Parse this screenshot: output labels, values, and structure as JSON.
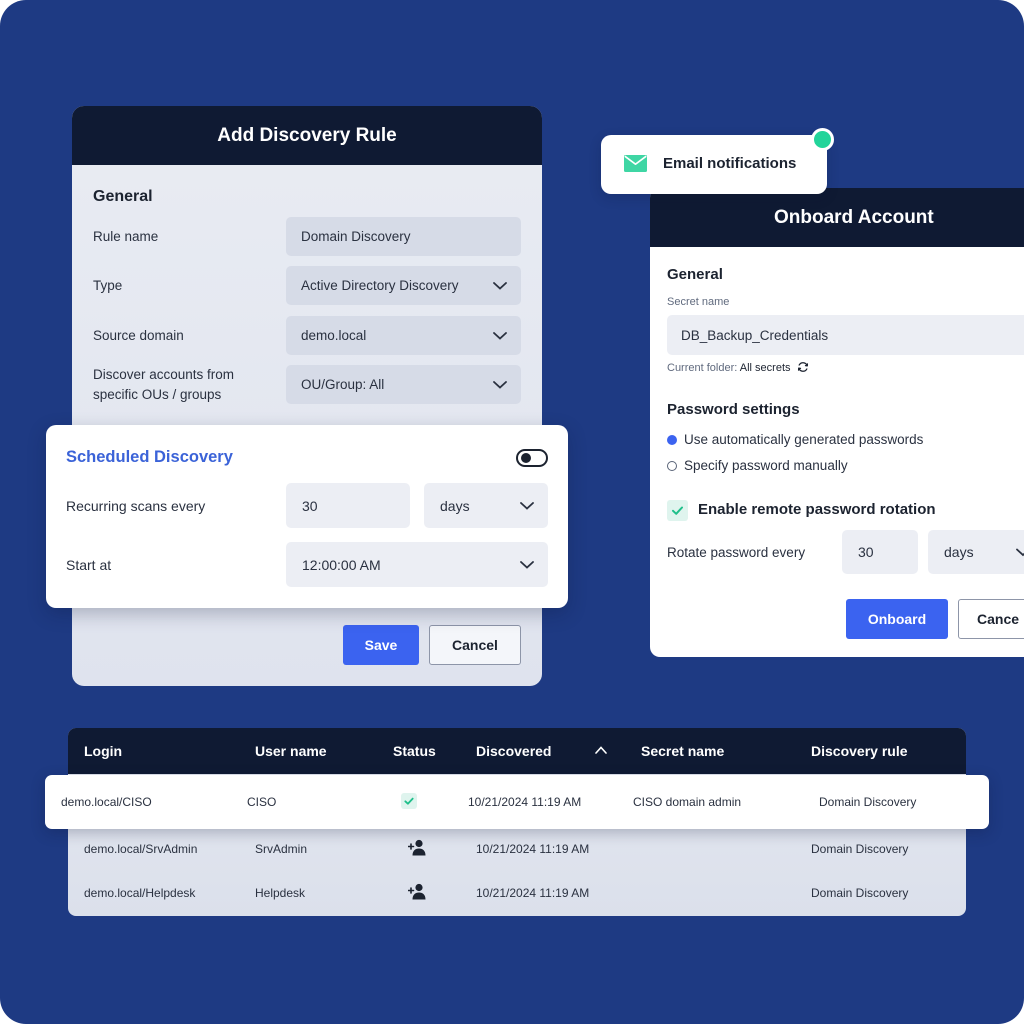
{
  "rule_card": {
    "title": "Add Discovery Rule",
    "section": "General",
    "fields": [
      {
        "label": "Rule name",
        "value": "Domain Discovery",
        "dropdown": false
      },
      {
        "label": "Type",
        "value": "Active Directory Discovery",
        "dropdown": true
      },
      {
        "label": "Source domain",
        "value": "demo.local",
        "dropdown": true
      },
      {
        "label": "Discover accounts from specific OUs / groups",
        "value": "OU/Group: All",
        "dropdown": true
      }
    ],
    "save_label": "Save",
    "cancel_label": "Cancel"
  },
  "scheduled": {
    "title": "Scheduled Discovery",
    "toggle_on": false,
    "recurring_label": "Recurring scans every",
    "recurring_value": "30",
    "recurring_unit": "days",
    "start_label": "Start at",
    "start_value": "12:00:00 AM"
  },
  "email": {
    "label": "Email notifications",
    "status_color": "#22d49a"
  },
  "onboard": {
    "title": "Onboard Account",
    "section": "General",
    "secret_name_label": "Secret name",
    "secret_name_value": "DB_Backup_Credentials",
    "current_folder_label": "Current folder:",
    "current_folder_value": "All secrets",
    "password_section": "Password settings",
    "option_auto": "Use automatically generated passwords",
    "option_manual": "Specify password manually",
    "rotation_label": "Enable remote password rotation",
    "rotate_label": "Rotate password every",
    "rotate_value": "30",
    "rotate_unit": "days",
    "onboard_label": "Onboard",
    "cancel_label": "Cance"
  },
  "table": {
    "columns": [
      "Login",
      "User name",
      "Status",
      "Discovered",
      "Secret name",
      "Discovery rule"
    ],
    "rows": [
      {
        "login": "demo.local/CISO",
        "user": "CISO",
        "status": "check-icon",
        "discovered": "10/21/2024 11:19 AM",
        "secret": "CISO domain admin",
        "rule": "Domain Discovery"
      },
      {
        "login": "demo.local/SrvAdmin",
        "user": "SrvAdmin",
        "status": "add-user-icon",
        "discovered": "10/21/2024 11:19 AM",
        "secret": "",
        "rule": "Domain Discovery"
      },
      {
        "login": "demo.local/Helpdesk",
        "user": "Helpdesk",
        "status": "add-user-icon",
        "discovered": "10/21/2024 11:19 AM",
        "secret": "",
        "rule": "Domain Discovery"
      }
    ]
  },
  "colors": {
    "background": "#1e3a83",
    "header": "#0f1a33",
    "accent": "#3b63f0",
    "sched_title": "#3b63d8",
    "success": "#22d49a"
  }
}
